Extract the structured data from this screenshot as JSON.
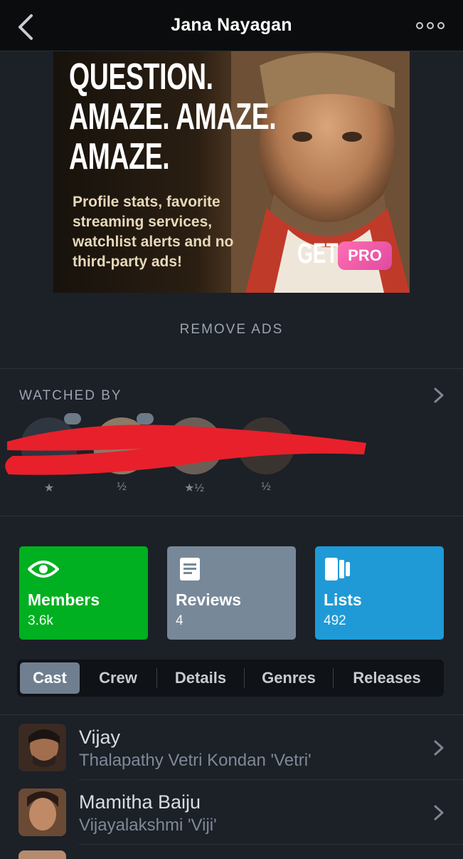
{
  "header": {
    "title": "Jana Nayagan",
    "back_icon": "chevron-left-icon",
    "more_icon": "ellipsis-icon"
  },
  "ad": {
    "headline": [
      "QUESTION.",
      "AMAZE. AMAZE.",
      "AMAZE."
    ],
    "subtext": "Profile stats, favorite streaming services, watchlist alerts and no third-party ads!",
    "cta_get": "GET",
    "cta_pro": "PRO"
  },
  "remove_ads": "REMOVE ADS",
  "watched_by": {
    "label": "WATCHED BY",
    "ratings": [
      "★",
      "½",
      "★½",
      "½"
    ]
  },
  "stats": [
    {
      "label": "Members",
      "value": "3.6k",
      "icon": "eye-icon",
      "color": "#00b020"
    },
    {
      "label": "Reviews",
      "value": "4",
      "icon": "document-icon",
      "color": "#778899"
    },
    {
      "label": "Lists",
      "value": "492",
      "icon": "lists-icon",
      "color": "#1f9ad6"
    }
  ],
  "tabs": [
    "Cast",
    "Crew",
    "Details",
    "Genres",
    "Releases"
  ],
  "active_tab": "Cast",
  "cast": [
    {
      "name": "Vijay",
      "role": "Thalapathy Vetri Kondan 'Vetri'"
    },
    {
      "name": "Mamitha Baiju",
      "role": "Vijayalakshmi 'Viji'"
    }
  ]
}
